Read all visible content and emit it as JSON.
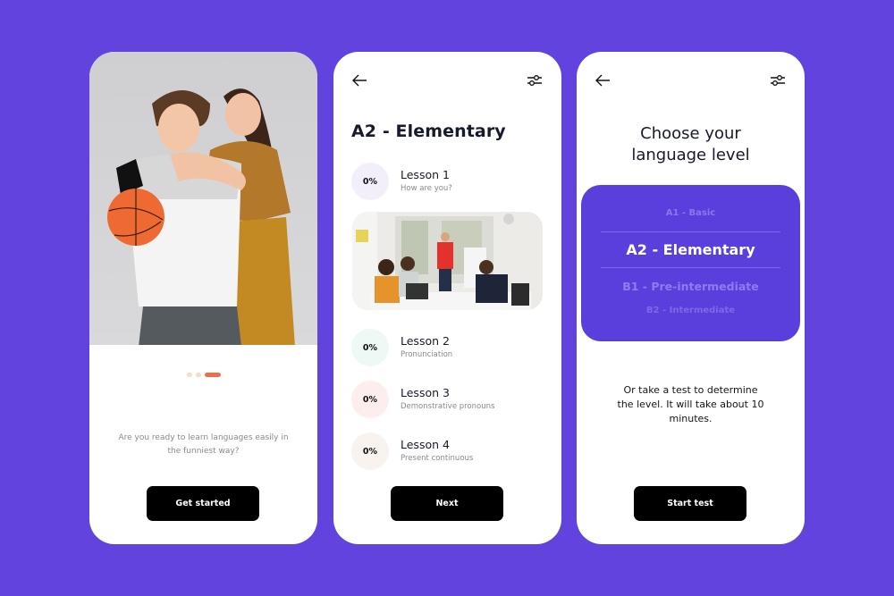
{
  "colors": {
    "background": "#6343de",
    "accent": "#f46b4b",
    "picker": "#5b3fdc",
    "button": "#000000"
  },
  "onboarding": {
    "hero_image": "two smiling kids with a basketball",
    "pager": {
      "pages": 3,
      "active": 3
    },
    "intro_text": "Are you ready to learn languages easily in the funniest way?",
    "cta_label": "Get started"
  },
  "lessons_screen": {
    "back_icon": "arrow-left-icon",
    "filter_icon": "sliders-icon",
    "title": "A2 - Elementary",
    "lessons": [
      {
        "progress": "0%",
        "title": "Lesson 1",
        "subtitle": "How are you?",
        "color": "#f3effa"
      },
      {
        "progress": "0%",
        "title": "Lesson 2",
        "subtitle": "Pronunciation",
        "color": "#eef8f5"
      },
      {
        "progress": "0%",
        "title": "Lesson 3",
        "subtitle": "Demonstrative pronouns",
        "color": "#fdeeee"
      },
      {
        "progress": "0%",
        "title": "Lesson 4",
        "subtitle": "Present continuous",
        "color": "#f8f3ef"
      }
    ],
    "photo": "classroom meeting with presenter at flipchart",
    "next_label": "Next"
  },
  "level_screen": {
    "back_icon": "arrow-left-icon",
    "filter_icon": "sliders-icon",
    "title_line1": "Choose your",
    "title_line2": "language level",
    "levels": [
      "A1 - Basic",
      "A2 - Elementary",
      "B1 - Pre-intermediate",
      "B2 - Intermediate"
    ],
    "selected_level": "A2 - Elementary",
    "note": "Or take a test to determine the level. It will take about 10 minutes.",
    "start_label": "Start test"
  }
}
